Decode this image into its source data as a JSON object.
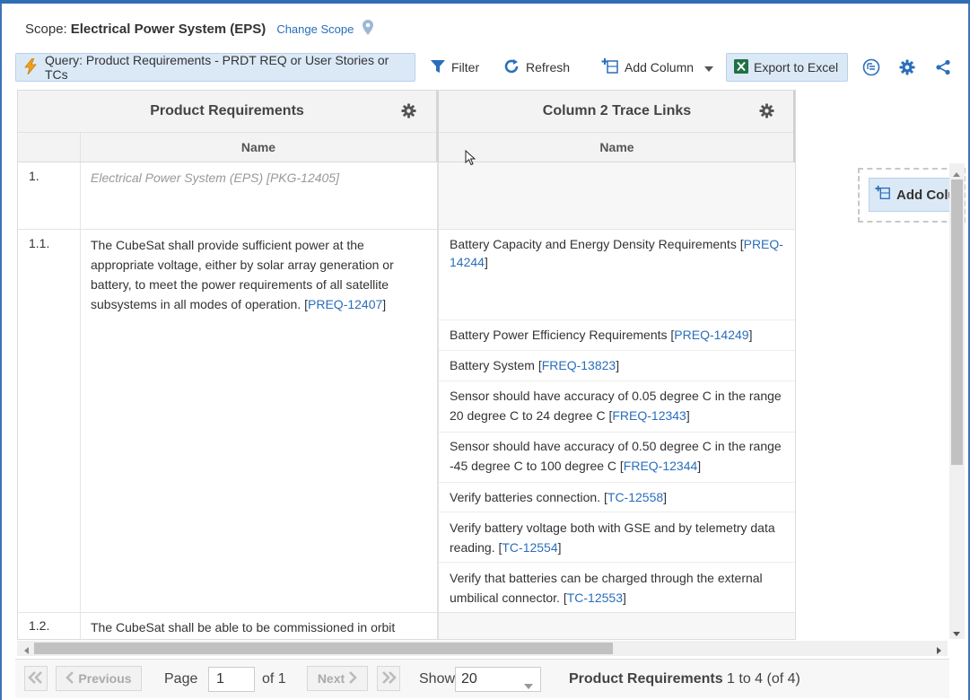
{
  "scope": {
    "label": "Scope:",
    "value": "Electrical Power System (EPS)",
    "change": "Change Scope"
  },
  "toolbar": {
    "query": "Query: Product Requirements - PRDT REQ or User Stories or TCs",
    "filter": "Filter",
    "refresh": "Refresh",
    "add_column": "Add Column",
    "export": "Export to Excel"
  },
  "grid": {
    "col1_title": "Product Requirements",
    "col1_sub": "Name",
    "col2_title": "Column 2 Trace Links",
    "col2_sub": "Name",
    "rows": [
      {
        "num": "1.",
        "text": "Electrical Power System (EPS) [PKG-12405]"
      },
      {
        "num": "1.1.",
        "text_plain": "The CubeSat shall provide sufficient power at the appropriate voltage, either by solar array generation or battery, to meet the power requirements of all satellite subsystems in all modes of operation. ",
        "text_link": "PREQ-12407"
      },
      {
        "num": "1.2.",
        "text_plain": "The CubeSat shall be able to be commissioned in orbit"
      }
    ],
    "links": [
      {
        "plain": "Battery Capacity and Energy Density Requirements ",
        "id": "PREQ-14244"
      },
      {
        "plain": "Battery Power Efficiency Requirements ",
        "id": "PREQ-14249"
      },
      {
        "plain": "Battery System ",
        "id": "FREQ-13823"
      },
      {
        "plain": "Sensor should have accuracy of 0.05 degree C in the range 20 degree C to 24 degree C ",
        "id": "FREQ-12343"
      },
      {
        "plain": "Sensor should have accuracy of 0.50 degree C in the range -45 degree C to 100 degree C ",
        "id": "FREQ-12344"
      },
      {
        "plain": "Verify batteries connection. ",
        "id": "TC-12558"
      },
      {
        "plain": "Verify battery voltage both with GSE and by telemetry data reading. ",
        "id": "TC-12554"
      },
      {
        "plain": "Verify that batteries can be charged through the external umbilical connector. ",
        "id": "TC-12553"
      }
    ]
  },
  "addcol_label": "Add Colu",
  "pager": {
    "previous": "Previous",
    "page_label": "Page",
    "page_value": "1",
    "of": "of 1",
    "next": "Next",
    "show": "Show",
    "show_value": "20",
    "summary_bold": "Product Requirements",
    "summary_rest": " 1 to 4 (of 4)"
  },
  "colors": {
    "accent": "#2a6ebb",
    "button_bg": "#dbe9f7",
    "excel_green": "#1e7145"
  }
}
